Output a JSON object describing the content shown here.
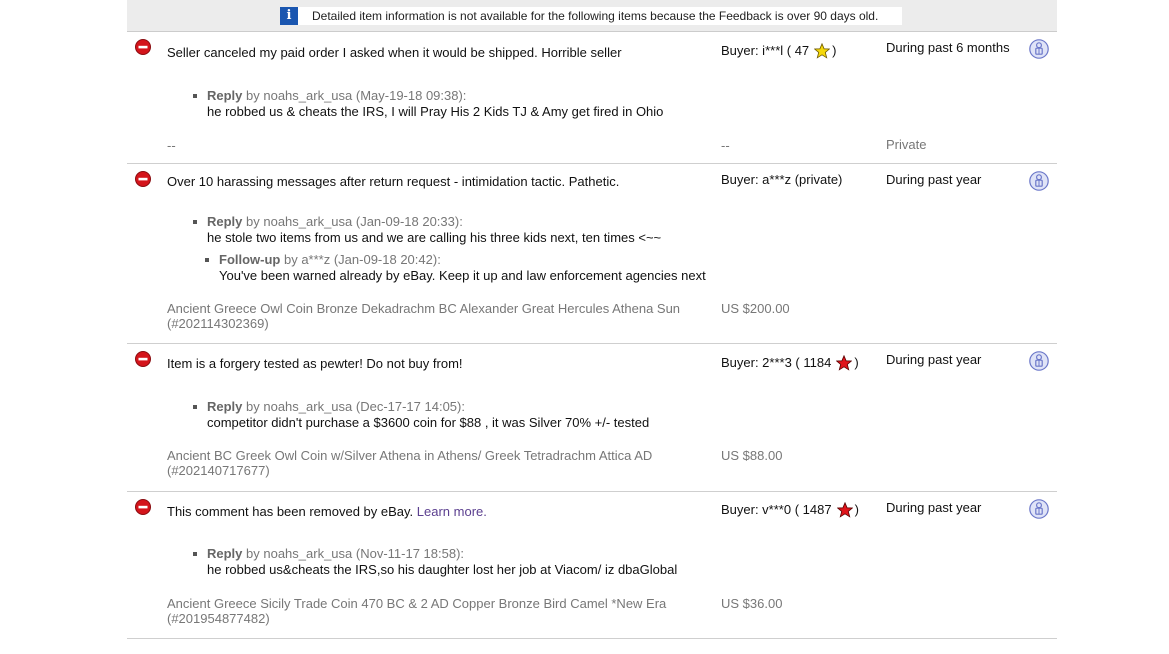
{
  "notice": {
    "text": "Detailed item information is not available for the following items because the Feedback is over 90 days old."
  },
  "rows": [
    {
      "comment": "Seller canceled my paid order I asked when it would be shipped. Horrible seller",
      "buyer_prefix": "Buyer: i***l ( 47",
      "buyer_suffix": ")",
      "star_color": "#f5d80a",
      "period": "During past 6 months",
      "replies": [
        {
          "label": "Reply",
          "head": " by noahs_ark_usa (May-19-18 09:38):",
          "body": "he robbed us & cheats the IRS, I will Pray His 2 Kids TJ & Amy get fired in Ohio"
        }
      ],
      "item": "--",
      "price": "--",
      "private": "Private"
    },
    {
      "comment": "Over 10 harassing messages after return request - intimidation tactic. Pathetic.",
      "buyer_prefix": "Buyer: a***z (private)",
      "period": "During past year",
      "replies": [
        {
          "label": "Reply",
          "head": " by noahs_ark_usa (Jan-09-18 20:33):",
          "body": "he stole two items from us and we are calling his three kids next, ten times <~~"
        },
        {
          "label": "Follow-up",
          "head": " by a***z (Jan-09-18 20:42):",
          "body": "You've been warned already by eBay. Keep it up and law enforcement agencies next"
        }
      ],
      "item_line1": "Ancient Greece Owl Coin Bronze Dekadrachm BC Alexander Great Hercules Athena Sun",
      "item_line2": "(#202114302369)",
      "price": "US $200.00"
    },
    {
      "comment": "Item is a forgery tested as pewter! Do not buy from!",
      "buyer_prefix": "Buyer: 2***3 ( 1184",
      "buyer_suffix": ")",
      "star_color": "#e0141b",
      "period": "During past year",
      "replies": [
        {
          "label": "Reply",
          "head": " by noahs_ark_usa (Dec-17-17 14:05):",
          "body": "competitor didn't purchase a $3600 coin for $88 , it was Silver 70% +/- tested"
        }
      ],
      "item_line1": "Ancient BC Greek Owl Coin w/Silver Athena in Athens/ Greek Tetradrachm Attica AD",
      "item_line2": "(#202140717677)",
      "price": "US $88.00"
    },
    {
      "comment": "This comment has been removed by eBay.",
      "learn_more": "Learn more.",
      "buyer_prefix": "Buyer: v***0 ( 1487",
      "buyer_suffix": ")",
      "star_color": "#e0141b",
      "period": "During past year",
      "replies": [
        {
          "label": "Reply",
          "head": " by noahs_ark_usa (Nov-11-17 18:58):",
          "body": "he robbed us&cheats the IRS,so his daughter lost her job at Viacom/ iz dbaGlobal"
        }
      ],
      "item_line1": "Ancient Greece Sicily Trade Coin 470 BC & 2 AD Copper Bronze Bird Camel *New Era",
      "item_line2": "(#201954877482)",
      "price": "US $36.00"
    }
  ]
}
